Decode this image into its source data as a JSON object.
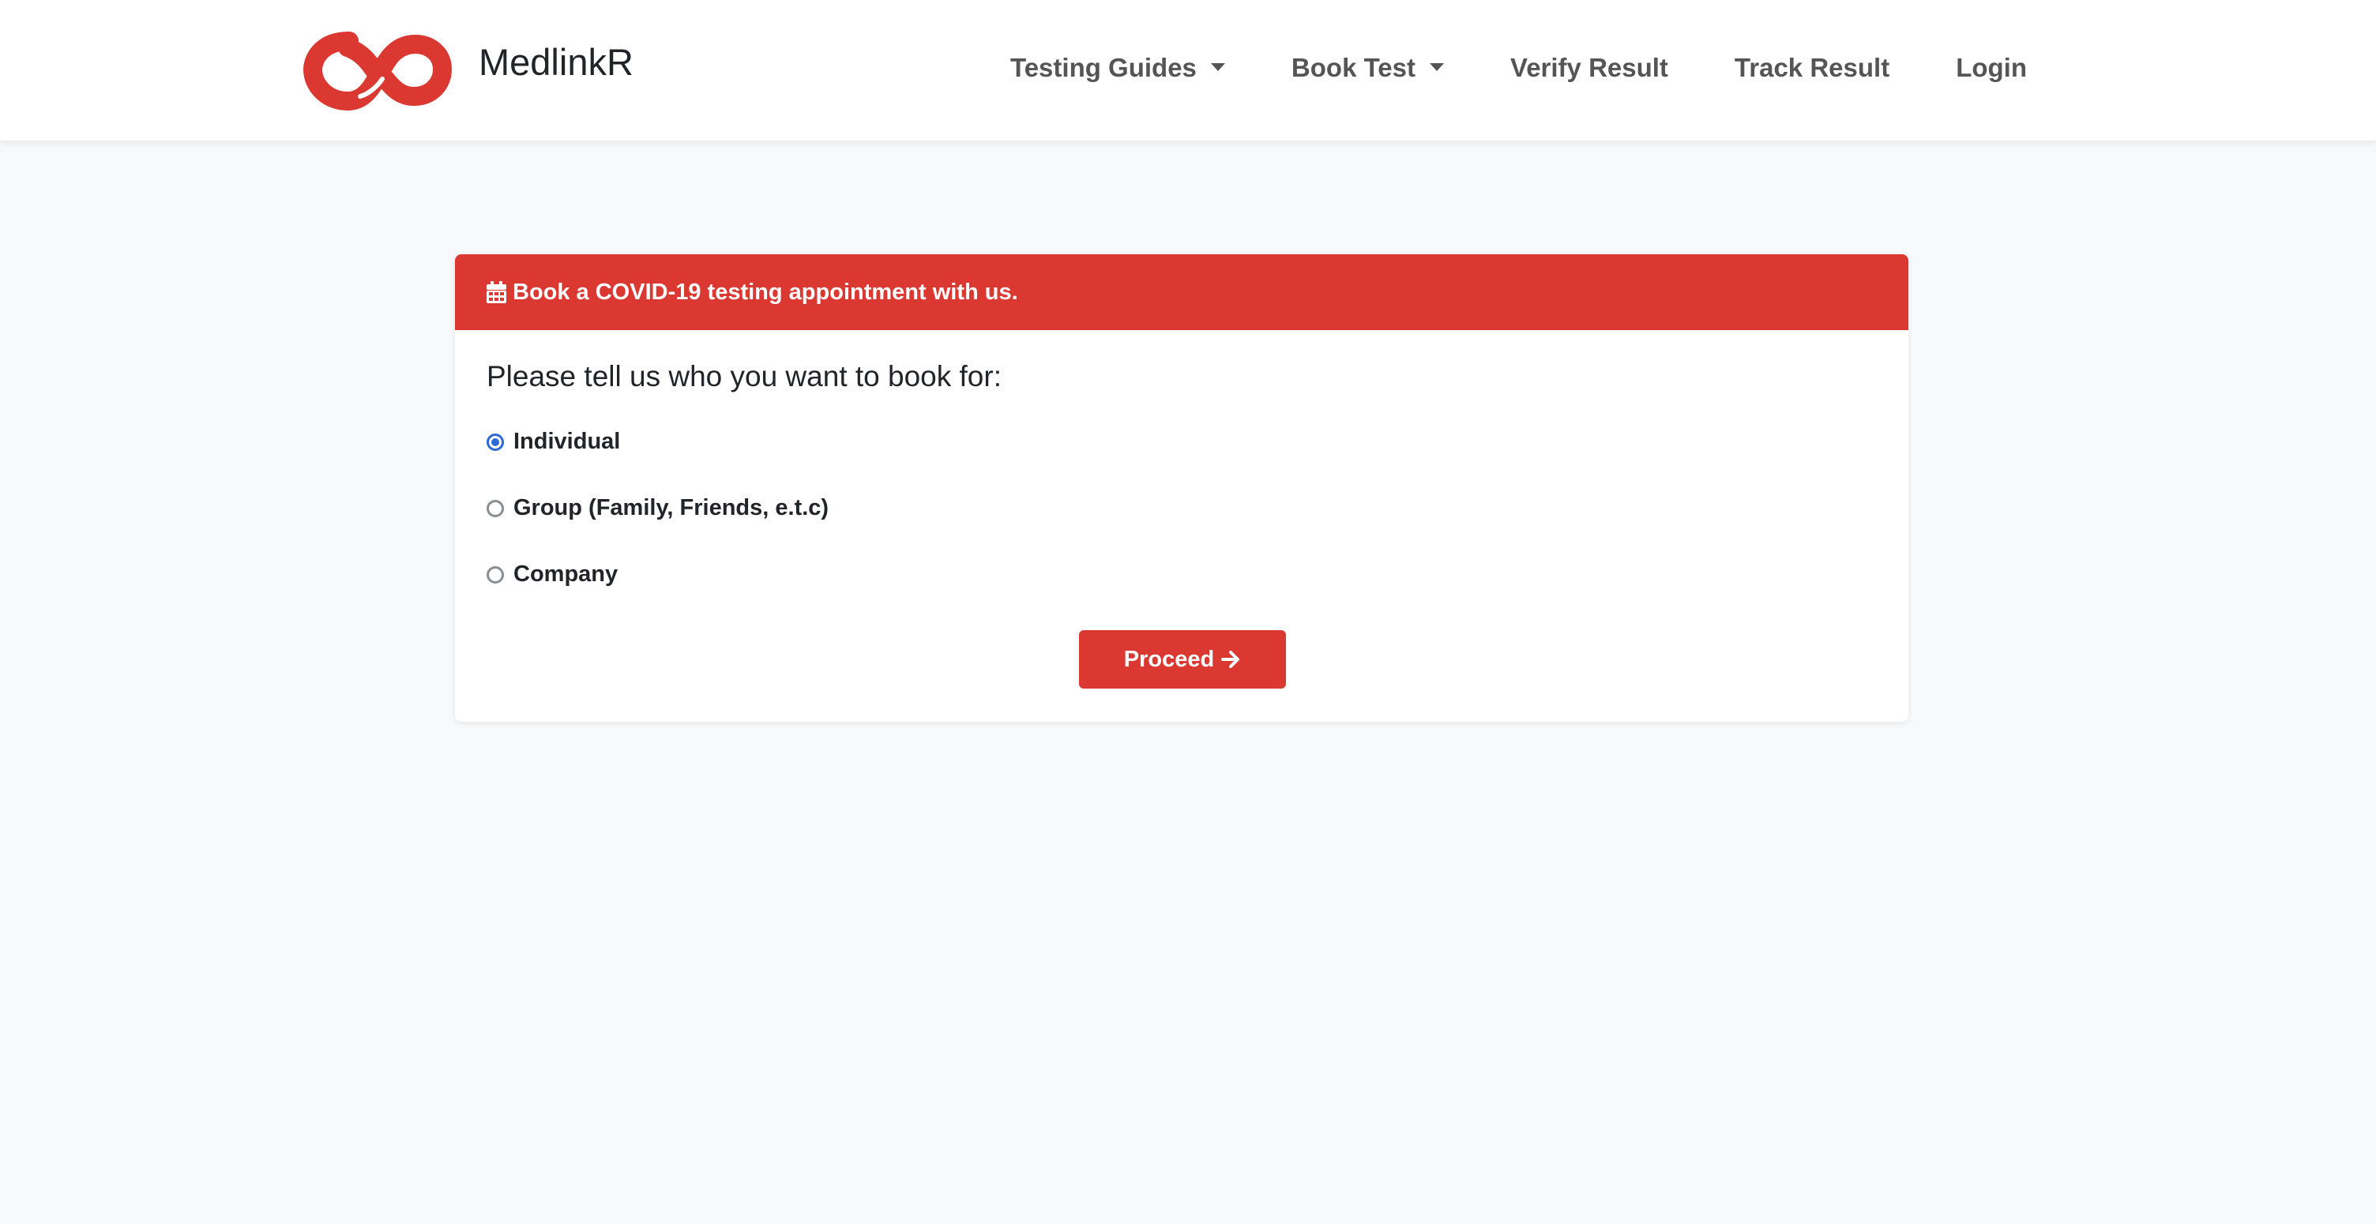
{
  "brand": {
    "name": "MedlinkR",
    "logo_icon": "infinity-logo-icon",
    "accent_color": "#dc3832"
  },
  "nav": {
    "items": [
      {
        "label": "Testing Guides",
        "has_dropdown": true
      },
      {
        "label": "Book Test",
        "has_dropdown": true
      },
      {
        "label": "Verify Result",
        "has_dropdown": false
      },
      {
        "label": "Track Result",
        "has_dropdown": false
      },
      {
        "label": "Login",
        "has_dropdown": false
      }
    ]
  },
  "card": {
    "header_icon": "calendar-icon",
    "header_title": "Book a COVID-19 testing appointment with us.",
    "question": "Please tell us who you want to book for:",
    "options": [
      {
        "label": "Individual",
        "selected": true
      },
      {
        "label": "Group (Family, Friends, e.t.c)",
        "selected": false
      },
      {
        "label": "Company",
        "selected": false
      }
    ],
    "proceed_label": "Proceed",
    "proceed_icon": "arrow-right-icon"
  }
}
